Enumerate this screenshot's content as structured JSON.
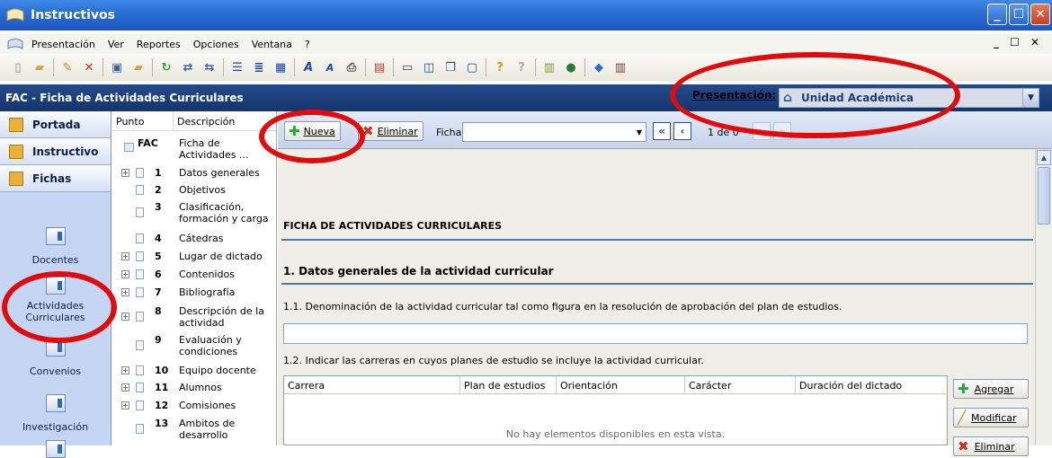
{
  "window": {
    "title": "Instructivos"
  },
  "menubar": {
    "items": [
      {
        "label": "Presentación"
      },
      {
        "label": "Ver"
      },
      {
        "label": "Reportes"
      },
      {
        "label": "Opciones"
      },
      {
        "label": "Ventana"
      },
      {
        "label": "?"
      }
    ],
    "controls": "_ ☐ ✕"
  },
  "header": {
    "title": "FAC - Ficha de Actividades Curriculares",
    "presentation_label": "Presentación:",
    "presentation_value": "Unidad Académica"
  },
  "leftnav": {
    "buttons": [
      {
        "label": "Portada"
      },
      {
        "label": "Instructivo"
      },
      {
        "label": "Fichas"
      }
    ],
    "items": [
      {
        "label": "Docentes"
      },
      {
        "label": "Actividades Curriculares"
      },
      {
        "label": "Convenios"
      },
      {
        "label": "Investigación"
      }
    ]
  },
  "tree": {
    "headers": {
      "punto": "Punto",
      "descripcion": "Descripción"
    },
    "root": {
      "code": "FAC",
      "label": "Ficha de Actividades ..."
    },
    "rows": [
      {
        "num": "1",
        "label": "Datos generales",
        "expandable": true
      },
      {
        "num": "2",
        "label": "Objetivos",
        "expandable": false
      },
      {
        "num": "3",
        "label": "Clasificación, formación y carga",
        "expandable": false
      },
      {
        "num": "4",
        "label": "Cátedras",
        "expandable": false
      },
      {
        "num": "5",
        "label": "Lugar de dictado",
        "expandable": true
      },
      {
        "num": "6",
        "label": "Contenidos",
        "expandable": true
      },
      {
        "num": "7",
        "label": "Bibliografía",
        "expandable": true
      },
      {
        "num": "8",
        "label": "Descripción de la actividad",
        "expandable": true
      },
      {
        "num": "9",
        "label": "Evaluación y condiciones",
        "expandable": false
      },
      {
        "num": "10",
        "label": "Equipo docente",
        "expandable": true
      },
      {
        "num": "11",
        "label": "Alumnos",
        "expandable": true
      },
      {
        "num": "12",
        "label": "Comisiones",
        "expandable": true
      },
      {
        "num": "13",
        "label": "Ambitos de desarrollo",
        "expandable": false
      }
    ]
  },
  "main": {
    "toolbar": {
      "nueva": "Nueva",
      "eliminar": "Eliminar",
      "ficha_label": "Ficha:",
      "ficha_value": "",
      "page": "1 de 0"
    },
    "section_title": "FICHA DE ACTIVIDADES CURRICULARES",
    "section1": "1. Datos generales de la actividad curricular",
    "q1": "1.1. Denominación de la actividad curricular tal como figura en la resolución de aprobación del plan de estudios.",
    "q1_value": "",
    "q2": "1.2. Indicar las carreras en cuyos planes de estudio se incluye la actividad curricular.",
    "grid": {
      "columns": [
        "Carrera",
        "Plan de estudios",
        "Orientación",
        "Carácter",
        "Duración del dictado"
      ],
      "empty_text": "No hay elementos disponibles en esta vista."
    },
    "side_buttons": {
      "agregar": "Agregar",
      "modificar": "Modificar",
      "eliminar": "Eliminar"
    }
  },
  "colors": {
    "titlebar": "#2a6fd6",
    "header": "#14356d",
    "leftnav": "#c4d6f4",
    "annotation": "#e20b0b",
    "add_icon": "#2fa13b",
    "delete_icon": "#d32d1e"
  }
}
